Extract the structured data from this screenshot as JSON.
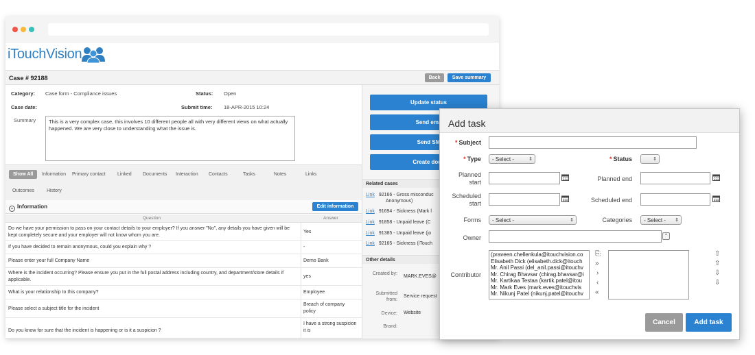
{
  "app": {
    "logo_text": "iTouchVision"
  },
  "case": {
    "title": "Case # 92188",
    "back_label": "Back",
    "save_summary_label": "Save summary",
    "category_label": "Category:",
    "category_value": "Case form - Compliance issues",
    "status_label": "Status:",
    "status_value": "Open",
    "case_date_label": "Case date:",
    "submit_time_label": "Submit time:",
    "submit_time_value": "18-APR-2015 10:24",
    "summary_label": "Summary",
    "summary_text": "This is a very complex case, this involves 10 different people all with very different views on what actually happened. We are very close to understanding what the issue is."
  },
  "tabs": [
    "Show All",
    "Information",
    "Primary contact",
    "Linked",
    "Documents",
    "Interaction",
    "Contacts",
    "Tasks",
    "Notes",
    "Links",
    "Outcomes",
    "History"
  ],
  "information": {
    "title": "Information",
    "edit_label": "Edit information",
    "question_header": "Question",
    "answer_header": "Answer",
    "rows": [
      {
        "q": "Do we have your permission to pass on your contact details to your employer? If you answer \"No\", any details you have given will be kept completely secure and your employer will not know whom you are.",
        "a": "Yes"
      },
      {
        "q": "If you have decided to remain anonymous, could you explain why ?",
        "a": "-"
      },
      {
        "q": "Please enter your full Company Name",
        "a": "Demo Bank"
      },
      {
        "q": "Where is the incident occurring? Please ensure you put in the full postal address including country, and department/store details if applicable.",
        "a": "yes"
      },
      {
        "q": "What is your relationship to this company?",
        "a": "Employee"
      },
      {
        "q": "Please select a subject title for the incident",
        "a": "Breach of company policy"
      },
      {
        "q": "Do you know for sure that the incident is happening or is it a suspicion ?",
        "a": "I have a strong suspicion it is"
      }
    ]
  },
  "actions": [
    "Update status",
    "Send ema",
    "Send SM",
    "Create docu"
  ],
  "related_cases": {
    "title": "Related cases",
    "link_label": "Link",
    "items": [
      "92166 - Gross misconduc",
      "Anonymous)",
      "91694 - Sickness (Mark l",
      "91858 - Unpaid leave (C",
      "91385 - Unpaid leave (jo",
      "92165 - Sickness (iTouch"
    ]
  },
  "other_details": {
    "title": "Other details",
    "created_by_label": "Created by:",
    "created_by_value": "MARK.EVES@",
    "submitted_from_label": "Submitted from:",
    "submitted_from_value": "Service request",
    "device_label": "Device:",
    "device_value": "Website",
    "brand_label": "Brand:"
  },
  "modal": {
    "title": "Add task",
    "subject_label": "Subject",
    "type_label": "Type",
    "type_value": "- Select -",
    "status_label": "Status",
    "status_value": "",
    "planned_start_label": "Planned start",
    "planned_end_label": "Planned end",
    "scheduled_start_label": "Scheduled start",
    "scheduled_end_label": "Scheduled end",
    "forms_label": "Forms",
    "forms_value": "- Select -",
    "categories_label": "Categories",
    "categories_value": "- Select -",
    "owner_label": "Owner",
    "contributor_label": "Contributor",
    "contributors": [
      "(praveen.chellenkula@itouchvision.co",
      "Elisabeth Dick (elisabeth.dick@itouch",
      "Mr. Anil Passi (del_anil.passi@itouchv",
      "Mr. Chirag Bhavsar (chirag.bhavsar@i",
      "Mr. Kartikaa Testaa (kartik.patel@itou",
      "Mr. Mark Eves (mark.eves@itouchvis",
      "Mr. Nikunj Patel (nikunj.patel@itouchv"
    ],
    "cancel_label": "Cancel",
    "add_label": "Add task"
  },
  "colors": {
    "primary": "#2a82d0",
    "secondary": "#9a9a9a",
    "required": "#d9302c"
  }
}
